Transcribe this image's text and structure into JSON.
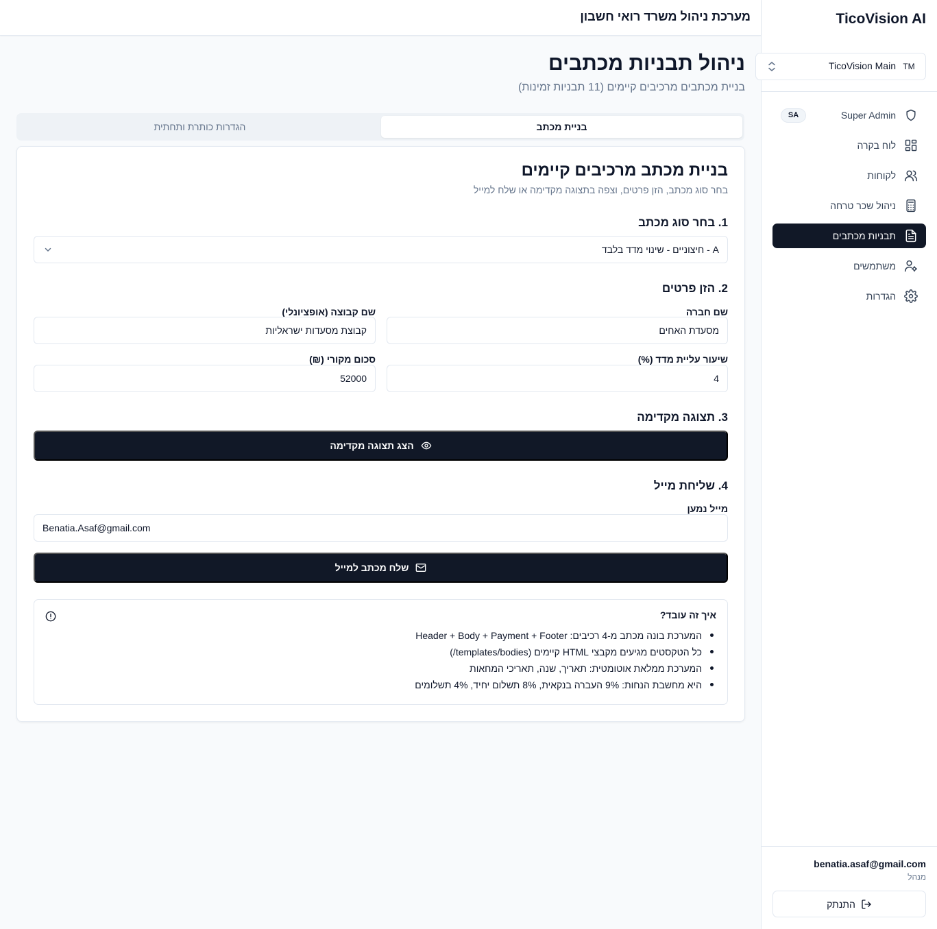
{
  "app": {
    "brand": "TicoVision AI",
    "header_title": "מערכת ניהול משרד רואי חשבון"
  },
  "sidebar": {
    "org": {
      "badge": "TM",
      "name": "TicoVision Main"
    },
    "items": [
      {
        "label": "Super Admin",
        "icon": "shield-icon",
        "badge": "SA",
        "active": false
      },
      {
        "label": "לוח בקרה",
        "icon": "dashboard-grid-icon",
        "active": false
      },
      {
        "label": "לקוחות",
        "icon": "users-icon",
        "active": false
      },
      {
        "label": "ניהול שכר טרחה",
        "icon": "calculator-icon",
        "active": false
      },
      {
        "label": "תבניות מכתבים",
        "icon": "file-text-icon",
        "active": true
      },
      {
        "label": "משתמשים",
        "icon": "user-cog-icon",
        "active": false
      },
      {
        "label": "הגדרות",
        "icon": "settings-gear-icon",
        "active": false
      }
    ],
    "user": {
      "email": "benatia.asaf@gmail.com",
      "role": "מנהל"
    },
    "logout_label": "התנתק"
  },
  "page": {
    "title": "ניהול תבניות מכתבים",
    "subtitle": "בניית מכתבים מרכיבים קיימים (11 תבניות זמינות)"
  },
  "tabs": [
    {
      "label": "בניית מכתב",
      "active": true
    },
    {
      "label": "הגדרות כותרת ותחתית",
      "active": false
    }
  ],
  "builder": {
    "title": "בניית מכתב מרכיבים קיימים",
    "description": "בחר סוג מכתב, הזן פרטים, וצפה בתצוגה מקדימה או שלח למייל",
    "step1": {
      "title": "1. בחר סוג מכתב",
      "selected": "A - חיצוניים - שינוי מדד בלבד"
    },
    "step2": {
      "title": "2. הזן פרטים",
      "company_label": "שם חברה",
      "company_value": "מסעדת האחים",
      "group_label": "שם קבוצה (אופציונלי)",
      "group_value": "קבוצת מסעדות ישראליות",
      "rate_label": "שיעור עליית מדד (%)",
      "rate_value": "4",
      "amount_label": "סכום מקורי (₪)",
      "amount_value": "52000"
    },
    "step3": {
      "title": "3. תצוגה מקדימה",
      "button_label": "הצג תצוגה מקדימה"
    },
    "step4": {
      "title": "4. שליחת מייל",
      "recipient_label": "מייל נמען",
      "recipient_value": "Benatia.Asaf@gmail.com",
      "button_label": "שלח מכתב למייל"
    },
    "info": {
      "title": "איך זה עובד?",
      "items": [
        "המערכת בונה מכתב מ-4 רכיבים: Header + Body + Payment + Footer",
        "כל הטקסטים מגיעים מקבצי HTML קיימים (templates/bodies/)",
        "המערכת ממלאת אוטומטית: תאריך, שנה, תאריכי המחאות",
        "היא מחשבת הנחות: 9% העברה בנקאית, 8% תשלום יחיד, 4% תשלומים"
      ]
    }
  },
  "colors": {
    "primary_dark": "#111827",
    "text": "#0f172a",
    "muted": "#64748b",
    "border": "#e2e8f0",
    "background": "#f8fafc"
  }
}
